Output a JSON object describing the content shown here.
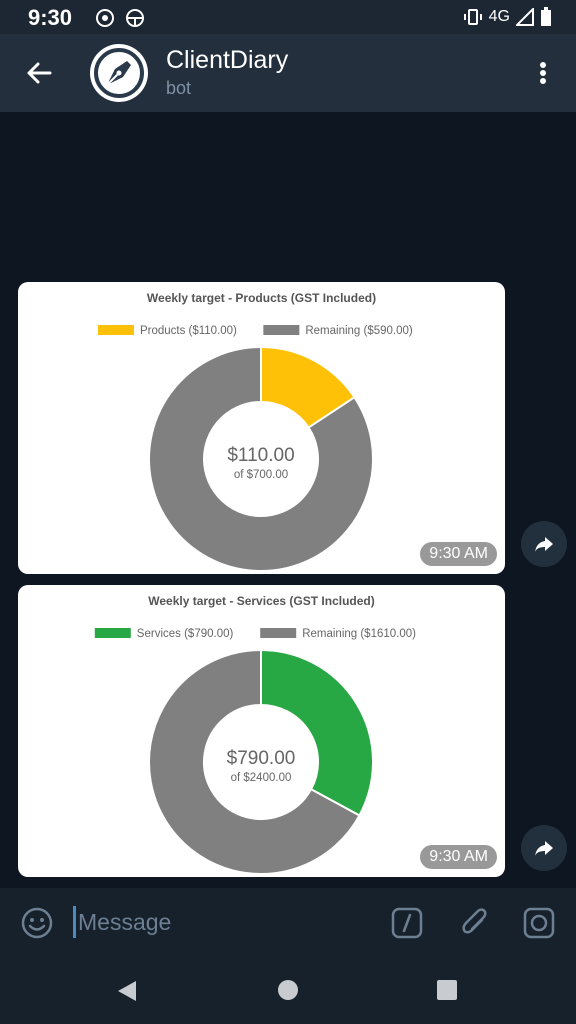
{
  "status_bar": {
    "time": "9:30",
    "network": "4G"
  },
  "header": {
    "title": "ClientDiary",
    "subtitle": "bot"
  },
  "messages": [
    {
      "time": "9:30 AM",
      "chart_data": {
        "type": "pie",
        "title": "Weekly target - Products (GST Included)",
        "categories": [
          "Products ($110.00)",
          "Remaining ($590.00)"
        ],
        "values": [
          110,
          590
        ],
        "colors": [
          "#ffc107",
          "#808080"
        ],
        "center_main": "$110.00",
        "center_sub": "of $700.00",
        "legend": "top"
      }
    },
    {
      "time": "9:30 AM",
      "chart_data": {
        "type": "pie",
        "title": "Weekly target - Services (GST Included)",
        "categories": [
          "Services ($790.00)",
          "Remaining ($1610.00)"
        ],
        "values": [
          790,
          1610
        ],
        "colors": [
          "#28a745",
          "#808080"
        ],
        "center_main": "$790.00",
        "center_sub": "of $2400.00",
        "legend": "top"
      }
    }
  ],
  "input": {
    "placeholder": "Message"
  },
  "icons": [
    "back-arrow-icon",
    "more-vert-icon",
    "share-icon",
    "emoji-icon",
    "bot-command-icon",
    "paperclip-icon",
    "camera-icon",
    "nav-back-icon",
    "nav-home-icon",
    "nav-recents-icon"
  ]
}
